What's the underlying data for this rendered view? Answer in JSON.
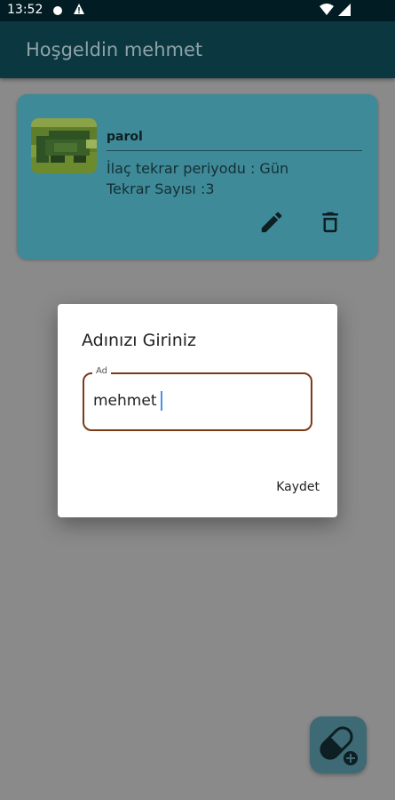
{
  "status_bar": {
    "time": "13:52",
    "icons": [
      "notification-dot-icon",
      "warning-icon",
      "wifi-icon",
      "signal-icon"
    ]
  },
  "app_bar": {
    "title": "Hoşgeldin mehmet"
  },
  "medications": [
    {
      "name": "parol",
      "period_line": "İlaç tekrar periyodu : Gün",
      "count_line": "Tekrar Sayısı :3",
      "icons": [
        "pill-image",
        "edit-icon",
        "delete-icon"
      ]
    }
  ],
  "dialog": {
    "title": "Adınızı Giriniz",
    "field_label": "Ad",
    "field_value": "mehmet",
    "save_label": "Kaydet"
  },
  "fab": {
    "icon": "pill-add-icon"
  },
  "colors": {
    "app_bar": "#0b3740",
    "card": "#3f8a98",
    "field_border": "#7a3a18",
    "caret": "#4a90e2",
    "scrim": "#8a8a8a"
  }
}
